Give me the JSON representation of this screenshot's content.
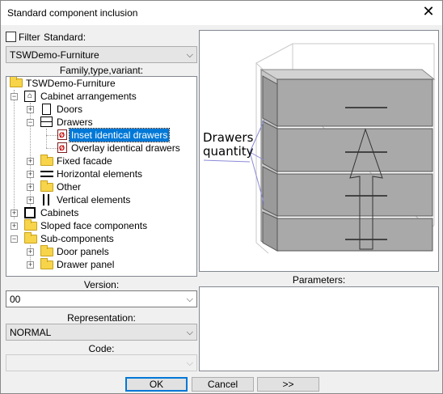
{
  "window": {
    "title": "Standard component inclusion"
  },
  "filter": {
    "checkbox_label": "Filter",
    "standard_label": "Standard:",
    "standard_value": "TSWDemo-Furniture"
  },
  "tree": {
    "header": "Family,type,variant:",
    "items": [
      {
        "label": "TSWDemo-Furniture",
        "icon": "folder-icon"
      },
      {
        "label": "Cabinet arrangements",
        "icon": "arrangement-icon"
      },
      {
        "label": "Doors",
        "icon": "door-icon"
      },
      {
        "label": "Drawers",
        "icon": "drawers-icon"
      },
      {
        "label": "Inset identical drawers",
        "icon": "component-icon",
        "selected": true
      },
      {
        "label": "Overlay identical drawers",
        "icon": "component-icon"
      },
      {
        "label": "Fixed facade",
        "icon": "folder-icon"
      },
      {
        "label": "Horizontal elements",
        "icon": "horizontal-icon"
      },
      {
        "label": "Other",
        "icon": "folder-icon"
      },
      {
        "label": "Vertical elements",
        "icon": "vertical-icon"
      },
      {
        "label": "Cabinets",
        "icon": "cabinet-icon"
      },
      {
        "label": "Sloped face components",
        "icon": "folder-icon"
      },
      {
        "label": "Sub-components",
        "icon": "folder-icon"
      },
      {
        "label": "Door panels",
        "icon": "folder-icon"
      },
      {
        "label": "Drawer panel",
        "icon": "folder-icon"
      }
    ]
  },
  "version": {
    "label": "Version:",
    "value": "00"
  },
  "representation": {
    "label": "Representation:",
    "value": "NORMAL"
  },
  "code": {
    "label": "Code:",
    "value": ""
  },
  "preview": {
    "annotation_line1": "Drawers",
    "annotation_line2": "quantity"
  },
  "parameters": {
    "label": "Parameters:"
  },
  "buttons": {
    "ok": "OK",
    "cancel": "Cancel",
    "more": ">>"
  },
  "colors": {
    "selection": "#0078d7",
    "folder": "#f7d44a",
    "drawer_front": "#a9a9a9"
  }
}
